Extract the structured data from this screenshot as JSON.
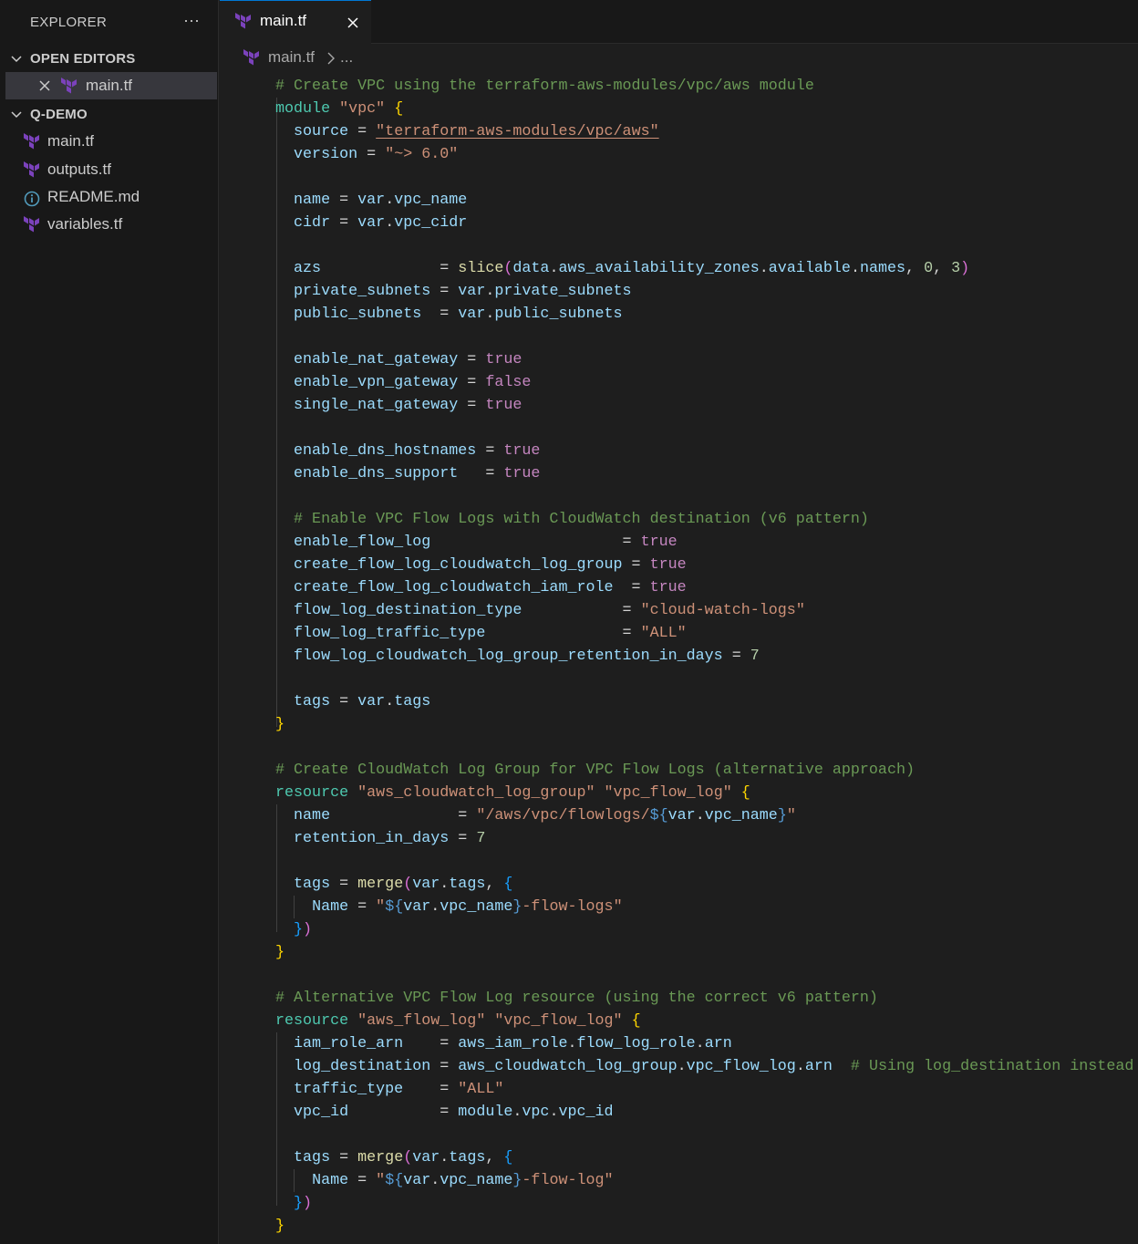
{
  "sidebar": {
    "title": "EXPLORER",
    "more_label": "···",
    "open_editors": {
      "label": "OPEN EDITORS",
      "items": [
        {
          "name": "main.tf",
          "icon": "terraform-icon"
        }
      ]
    },
    "workspace": {
      "label": "Q-DEMO",
      "files": [
        {
          "name": "main.tf",
          "icon": "terraform-icon"
        },
        {
          "name": "outputs.tf",
          "icon": "terraform-icon"
        },
        {
          "name": "README.md",
          "icon": "info-icon"
        },
        {
          "name": "variables.tf",
          "icon": "terraform-icon"
        }
      ]
    }
  },
  "tabs": [
    {
      "label": "main.tf",
      "icon": "terraform-icon",
      "active": true
    }
  ],
  "breadcrumb": {
    "file": "main.tf",
    "more": "..."
  },
  "colors": {
    "comment": "#6a9955",
    "keyword": "#4ec9b0",
    "string": "#ce9178",
    "identifier": "#9cdcfe",
    "number": "#b5cea8",
    "boolean": "#c586c0",
    "function": "#dcdcaa",
    "bracket_1": "#ffd700",
    "bracket_2": "#da70d6",
    "bracket_3": "#179fff",
    "terraform": "#7b42bc",
    "active_tab_border": "#0078d4"
  },
  "code": {
    "lines": [
      [
        [
          "cm",
          "# Create VPC using the terraform-aws-modules/vpc/aws module"
        ]
      ],
      [
        [
          "kw",
          "module"
        ],
        [
          "op",
          " "
        ],
        [
          "str",
          "\"vpc\""
        ],
        [
          "op",
          " "
        ],
        [
          "b1",
          "{"
        ]
      ],
      [
        [
          "op",
          "  "
        ],
        [
          "var",
          "source"
        ],
        [
          "op",
          " = "
        ],
        [
          "link",
          "\"terraform-aws-modules/vpc/aws\""
        ]
      ],
      [
        [
          "op",
          "  "
        ],
        [
          "var",
          "version"
        ],
        [
          "op",
          " = "
        ],
        [
          "str",
          "\"~> 6.0\""
        ]
      ],
      [],
      [
        [
          "op",
          "  "
        ],
        [
          "var",
          "name"
        ],
        [
          "op",
          " = "
        ],
        [
          "var",
          "var"
        ],
        [
          "op",
          "."
        ],
        [
          "var",
          "vpc_name"
        ]
      ],
      [
        [
          "op",
          "  "
        ],
        [
          "var",
          "cidr"
        ],
        [
          "op",
          " = "
        ],
        [
          "var",
          "var"
        ],
        [
          "op",
          "."
        ],
        [
          "var",
          "vpc_cidr"
        ]
      ],
      [],
      [
        [
          "op",
          "  "
        ],
        [
          "var",
          "azs"
        ],
        [
          "op",
          "             = "
        ],
        [
          "fn",
          "slice"
        ],
        [
          "b2",
          "("
        ],
        [
          "var",
          "data"
        ],
        [
          "op",
          "."
        ],
        [
          "var",
          "aws_availability_zones"
        ],
        [
          "op",
          "."
        ],
        [
          "var",
          "available"
        ],
        [
          "op",
          "."
        ],
        [
          "var",
          "names"
        ],
        [
          "op",
          ", "
        ],
        [
          "num",
          "0"
        ],
        [
          "op",
          ", "
        ],
        [
          "num",
          "3"
        ],
        [
          "b2",
          ")"
        ]
      ],
      [
        [
          "op",
          "  "
        ],
        [
          "var",
          "private_subnets"
        ],
        [
          "op",
          " = "
        ],
        [
          "var",
          "var"
        ],
        [
          "op",
          "."
        ],
        [
          "var",
          "private_subnets"
        ]
      ],
      [
        [
          "op",
          "  "
        ],
        [
          "var",
          "public_subnets"
        ],
        [
          "op",
          "  = "
        ],
        [
          "var",
          "var"
        ],
        [
          "op",
          "."
        ],
        [
          "var",
          "public_subnets"
        ]
      ],
      [],
      [
        [
          "op",
          "  "
        ],
        [
          "var",
          "enable_nat_gateway"
        ],
        [
          "op",
          " = "
        ],
        [
          "bool",
          "true"
        ]
      ],
      [
        [
          "op",
          "  "
        ],
        [
          "var",
          "enable_vpn_gateway"
        ],
        [
          "op",
          " = "
        ],
        [
          "bool",
          "false"
        ]
      ],
      [
        [
          "op",
          "  "
        ],
        [
          "var",
          "single_nat_gateway"
        ],
        [
          "op",
          " = "
        ],
        [
          "bool",
          "true"
        ]
      ],
      [],
      [
        [
          "op",
          "  "
        ],
        [
          "var",
          "enable_dns_hostnames"
        ],
        [
          "op",
          " = "
        ],
        [
          "bool",
          "true"
        ]
      ],
      [
        [
          "op",
          "  "
        ],
        [
          "var",
          "enable_dns_support"
        ],
        [
          "op",
          "   = "
        ],
        [
          "bool",
          "true"
        ]
      ],
      [],
      [
        [
          "op",
          "  "
        ],
        [
          "cm",
          "# Enable VPC Flow Logs with CloudWatch destination (v6 pattern)"
        ]
      ],
      [
        [
          "op",
          "  "
        ],
        [
          "var",
          "enable_flow_log"
        ],
        [
          "op",
          "                     = "
        ],
        [
          "bool",
          "true"
        ]
      ],
      [
        [
          "op",
          "  "
        ],
        [
          "var",
          "create_flow_log_cloudwatch_log_group"
        ],
        [
          "op",
          " = "
        ],
        [
          "bool",
          "true"
        ]
      ],
      [
        [
          "op",
          "  "
        ],
        [
          "var",
          "create_flow_log_cloudwatch_iam_role"
        ],
        [
          "op",
          "  = "
        ],
        [
          "bool",
          "true"
        ]
      ],
      [
        [
          "op",
          "  "
        ],
        [
          "var",
          "flow_log_destination_type"
        ],
        [
          "op",
          "           = "
        ],
        [
          "str",
          "\"cloud-watch-logs\""
        ]
      ],
      [
        [
          "op",
          "  "
        ],
        [
          "var",
          "flow_log_traffic_type"
        ],
        [
          "op",
          "               = "
        ],
        [
          "str",
          "\"ALL\""
        ]
      ],
      [
        [
          "op",
          "  "
        ],
        [
          "var",
          "flow_log_cloudwatch_log_group_retention_in_days"
        ],
        [
          "op",
          " = "
        ],
        [
          "num",
          "7"
        ]
      ],
      [],
      [
        [
          "op",
          "  "
        ],
        [
          "var",
          "tags"
        ],
        [
          "op",
          " = "
        ],
        [
          "var",
          "var"
        ],
        [
          "op",
          "."
        ],
        [
          "var",
          "tags"
        ]
      ],
      [
        [
          "b1",
          "}"
        ]
      ],
      [],
      [
        [
          "cm",
          "# Create CloudWatch Log Group for VPC Flow Logs (alternative approach)"
        ]
      ],
      [
        [
          "kw",
          "resource"
        ],
        [
          "op",
          " "
        ],
        [
          "str",
          "\"aws_cloudwatch_log_group\""
        ],
        [
          "op",
          " "
        ],
        [
          "str",
          "\"vpc_flow_log\""
        ],
        [
          "op",
          " "
        ],
        [
          "b1",
          "{"
        ]
      ],
      [
        [
          "op",
          "  "
        ],
        [
          "var",
          "name"
        ],
        [
          "op",
          "              = "
        ],
        [
          "str",
          "\"/aws/vpc/flowlogs/"
        ],
        [
          "interp",
          "${"
        ],
        [
          "var",
          "var"
        ],
        [
          "op",
          "."
        ],
        [
          "var",
          "vpc_name"
        ],
        [
          "interp",
          "}"
        ],
        [
          "str",
          "\""
        ]
      ],
      [
        [
          "op",
          "  "
        ],
        [
          "var",
          "retention_in_days"
        ],
        [
          "op",
          " = "
        ],
        [
          "num",
          "7"
        ]
      ],
      [],
      [
        [
          "op",
          "  "
        ],
        [
          "var",
          "tags"
        ],
        [
          "op",
          " = "
        ],
        [
          "fn",
          "merge"
        ],
        [
          "b2",
          "("
        ],
        [
          "var",
          "var"
        ],
        [
          "op",
          "."
        ],
        [
          "var",
          "tags"
        ],
        [
          "op",
          ", "
        ],
        [
          "b3",
          "{"
        ]
      ],
      [
        [
          "op",
          "    "
        ],
        [
          "var",
          "Name"
        ],
        [
          "op",
          " = "
        ],
        [
          "str",
          "\""
        ],
        [
          "interp",
          "${"
        ],
        [
          "var",
          "var"
        ],
        [
          "op",
          "."
        ],
        [
          "var",
          "vpc_name"
        ],
        [
          "interp",
          "}"
        ],
        [
          "str",
          "-flow-logs\""
        ]
      ],
      [
        [
          "op",
          "  "
        ],
        [
          "b3",
          "}"
        ],
        [
          "b2",
          ")"
        ]
      ],
      [
        [
          "b1",
          "}"
        ]
      ],
      [],
      [
        [
          "cm",
          "# Alternative VPC Flow Log resource (using the correct v6 pattern)"
        ]
      ],
      [
        [
          "kw",
          "resource"
        ],
        [
          "op",
          " "
        ],
        [
          "str",
          "\"aws_flow_log\""
        ],
        [
          "op",
          " "
        ],
        [
          "str",
          "\"vpc_flow_log\""
        ],
        [
          "op",
          " "
        ],
        [
          "b1",
          "{"
        ]
      ],
      [
        [
          "op",
          "  "
        ],
        [
          "var",
          "iam_role_arn"
        ],
        [
          "op",
          "    = "
        ],
        [
          "var",
          "aws_iam_role"
        ],
        [
          "op",
          "."
        ],
        [
          "var",
          "flow_log_role"
        ],
        [
          "op",
          "."
        ],
        [
          "var",
          "arn"
        ]
      ],
      [
        [
          "op",
          "  "
        ],
        [
          "var",
          "log_destination"
        ],
        [
          "op",
          " = "
        ],
        [
          "var",
          "aws_cloudwatch_log_group"
        ],
        [
          "op",
          "."
        ],
        [
          "var",
          "vpc_flow_log"
        ],
        [
          "op",
          "."
        ],
        [
          "var",
          "arn"
        ],
        [
          "op",
          "  "
        ],
        [
          "cm",
          "# Using log_destination instead"
        ]
      ],
      [
        [
          "op",
          "  "
        ],
        [
          "var",
          "traffic_type"
        ],
        [
          "op",
          "    = "
        ],
        [
          "str",
          "\"ALL\""
        ]
      ],
      [
        [
          "op",
          "  "
        ],
        [
          "var",
          "vpc_id"
        ],
        [
          "op",
          "          = "
        ],
        [
          "var",
          "module"
        ],
        [
          "op",
          "."
        ],
        [
          "var",
          "vpc"
        ],
        [
          "op",
          "."
        ],
        [
          "var",
          "vpc_id"
        ]
      ],
      [],
      [
        [
          "op",
          "  "
        ],
        [
          "var",
          "tags"
        ],
        [
          "op",
          " = "
        ],
        [
          "fn",
          "merge"
        ],
        [
          "b2",
          "("
        ],
        [
          "var",
          "var"
        ],
        [
          "op",
          "."
        ],
        [
          "var",
          "tags"
        ],
        [
          "op",
          ", "
        ],
        [
          "b3",
          "{"
        ]
      ],
      [
        [
          "op",
          "    "
        ],
        [
          "var",
          "Name"
        ],
        [
          "op",
          " = "
        ],
        [
          "str",
          "\""
        ],
        [
          "interp",
          "${"
        ],
        [
          "var",
          "var"
        ],
        [
          "op",
          "."
        ],
        [
          "var",
          "vpc_name"
        ],
        [
          "interp",
          "}"
        ],
        [
          "str",
          "-flow-log\""
        ]
      ],
      [
        [
          "op",
          "  "
        ],
        [
          "b3",
          "}"
        ],
        [
          "b2",
          ")"
        ]
      ],
      [
        [
          "b1",
          "}"
        ]
      ]
    ]
  }
}
